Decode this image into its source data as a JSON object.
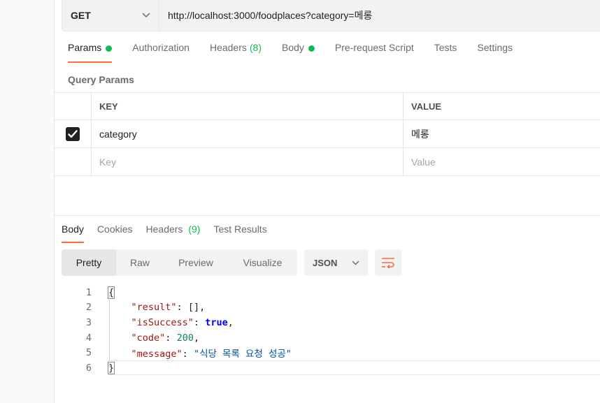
{
  "request": {
    "method": "GET",
    "url": "http://localhost:3000/foodplaces?category=메롱"
  },
  "request_tabs": [
    {
      "label": "Params",
      "dot": true,
      "active": true
    },
    {
      "label": "Authorization"
    },
    {
      "label": "Headers",
      "count": "(8)"
    },
    {
      "label": "Body",
      "dot": true
    },
    {
      "label": "Pre-request Script"
    },
    {
      "label": "Tests"
    },
    {
      "label": "Settings"
    }
  ],
  "query_params": {
    "title": "Query Params",
    "columns": {
      "key": "KEY",
      "value": "VALUE"
    },
    "rows": [
      {
        "checked": true,
        "key": "category",
        "value": "메롱"
      }
    ],
    "placeholders": {
      "key": "Key",
      "value": "Value"
    }
  },
  "response_tabs": [
    {
      "label": "Body",
      "active": true
    },
    {
      "label": "Cookies"
    },
    {
      "label": "Headers",
      "count": "(9)"
    },
    {
      "label": "Test Results"
    }
  ],
  "view_modes": [
    "Pretty",
    "Raw",
    "Preview",
    "Visualize"
  ],
  "active_view": "Pretty",
  "format": "JSON",
  "response_body": {
    "line_numbers": [
      "1",
      "2",
      "3",
      "4",
      "5",
      "6"
    ],
    "open_brace": "{",
    "close_brace": "}",
    "result_key": "\"result\"",
    "result_value": "[]",
    "isSuccess_key": "\"isSuccess\"",
    "isSuccess_value": "true",
    "code_key": "\"code\"",
    "code_value": "200",
    "message_key": "\"message\"",
    "message_value": "\"식당 목록 요청 성공\""
  },
  "colors": {
    "accent": "#ff6c37",
    "status_dot": "#0cbb52"
  }
}
